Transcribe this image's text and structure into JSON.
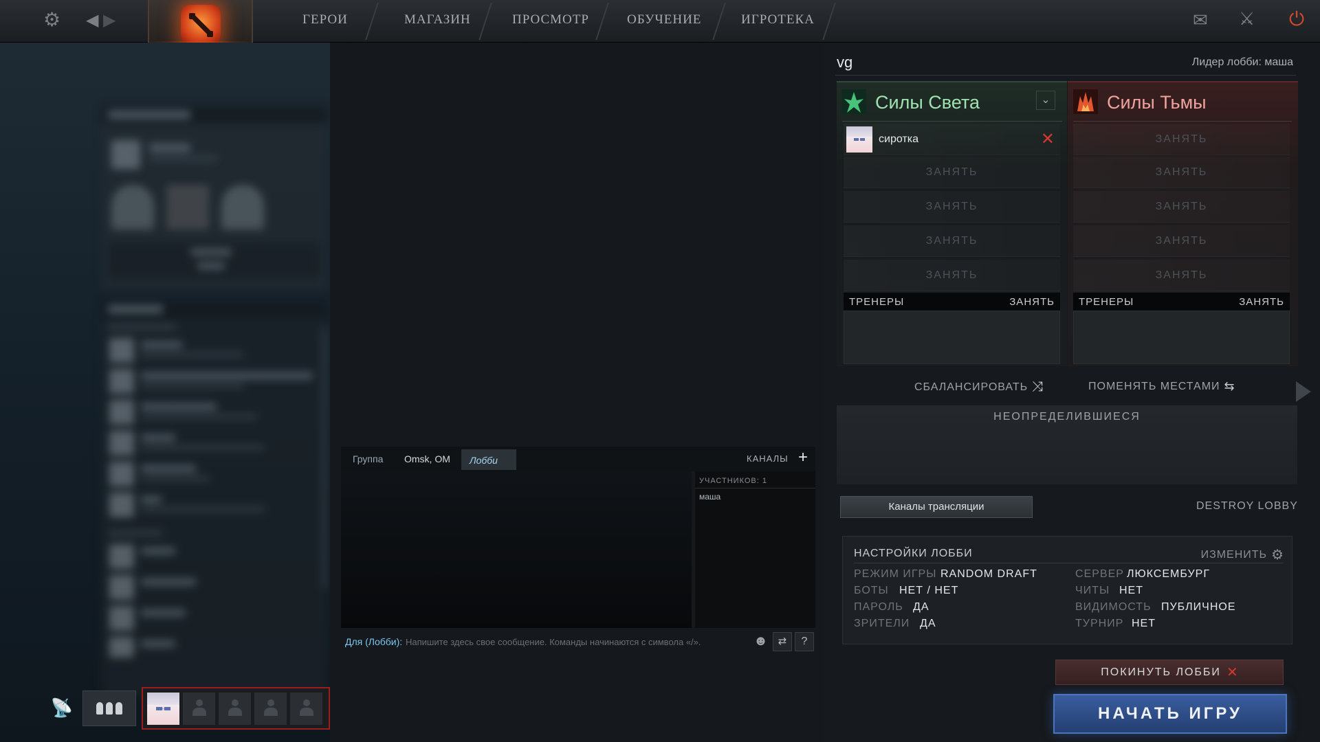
{
  "nav": {
    "items": [
      "ГЕРОИ",
      "МАГАЗИН",
      "ПРОСМОТР",
      "ОБУЧЕНИЕ",
      "ИГРОТЕКА"
    ]
  },
  "chat": {
    "tabs": {
      "group": "Группа",
      "omsk": "Omsk, OM",
      "lobby": "Лобби"
    },
    "channels_label": "КАНАЛЫ",
    "members_count": "УЧАСТНИКОВ: 1",
    "member": "маша",
    "input_prefix": "Для (Лобби):",
    "input_placeholder": "Напишите здесь свое сообщение. Команды начинаются с символа «/»."
  },
  "lobby": {
    "name": "vg",
    "leader": "Лидер лобби: маша",
    "radiant": {
      "title": "Силы Света",
      "player": "сиротка",
      "empty_slot": "ЗАНЯТЬ",
      "coaches": "ТРЕНЕРЫ",
      "coach_take": "ЗАНЯТЬ"
    },
    "dire": {
      "title": "Силы Тьмы",
      "empty_slot": "ЗАНЯТЬ",
      "coaches": "ТРЕНЕРЫ",
      "coach_take": "ЗАНЯТЬ"
    },
    "balance": "СБАЛАНСИРОВАТЬ",
    "swap": "ПОМЕНЯТЬ МЕСТАМИ",
    "undecided": "НЕОПРЕДЕЛИВШИЕСЯ",
    "broadcast": "Каналы трансляции",
    "destroy": "DESTROY LOBBY",
    "settings": {
      "title": "НАСТРОЙКИ ЛОББИ",
      "edit": "ИЗМЕНИТЬ",
      "game_mode_k": "РЕЖИМ ИГРЫ",
      "game_mode_v": "RANDOM DRAFT",
      "bots_k": "БОТЫ",
      "bots_v": "НЕТ / НЕТ",
      "password_k": "ПАРОЛЬ",
      "password_v": "ДА",
      "spectators_k": "ЗРИТЕЛИ",
      "spectators_v": "ДА",
      "server_k": "СЕРВЕР",
      "server_v": "ЛЮКСЕМБУРГ",
      "cheats_k": "ЧИТЫ",
      "cheats_v": "НЕТ",
      "visibility_k": "ВИДИМОСТЬ",
      "visibility_v": "ПУБЛИЧНОЕ",
      "tournament_k": "ТУРНИР",
      "tournament_v": "НЕТ"
    },
    "leave": "ПОКИНУТЬ ЛОББИ",
    "start": "НАЧАТЬ ИГРУ"
  },
  "colors": {
    "radiant": "#9fe3b0",
    "dire": "#f0a39c",
    "start": "#2f5190"
  }
}
